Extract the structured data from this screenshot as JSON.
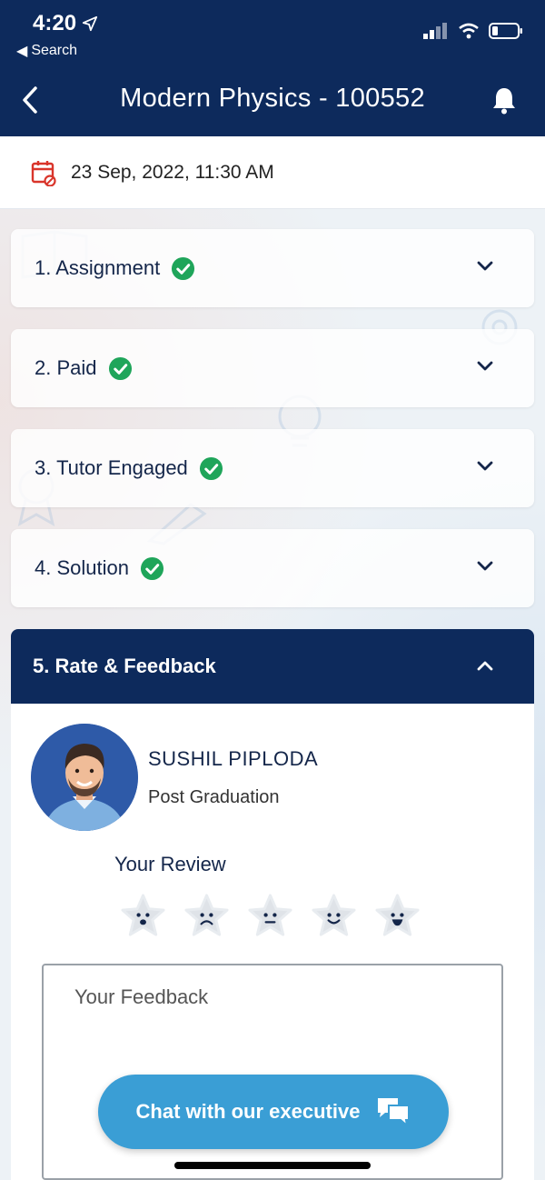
{
  "status_bar": {
    "time": "4:20",
    "back_app": "Search"
  },
  "nav": {
    "title": "Modern Physics - 100552"
  },
  "date_bar": {
    "datetime": "23 Sep, 2022,  11:30 AM"
  },
  "steps": [
    {
      "label": "1. Assignment",
      "completed": true
    },
    {
      "label": "2. Paid",
      "completed": true
    },
    {
      "label": "3. Tutor Engaged",
      "completed": true
    },
    {
      "label": "4. Solution",
      "completed": true
    }
  ],
  "rate_section": {
    "title": "5. Rate & Feedback",
    "tutor_name": "SUSHIL PIPLODA",
    "tutor_degree": "Post Graduation",
    "review_label": "Your Review",
    "feedback_placeholder": "Your Feedback",
    "stars": [
      "very-bad",
      "bad",
      "neutral",
      "good",
      "excellent"
    ]
  },
  "chat_button": {
    "label": "Chat with our executive"
  },
  "colors": {
    "navy": "#0d2a5c",
    "accent_blue": "#3a9ed5",
    "check_green": "#1fa55a",
    "calendar_red": "#d9352b"
  }
}
